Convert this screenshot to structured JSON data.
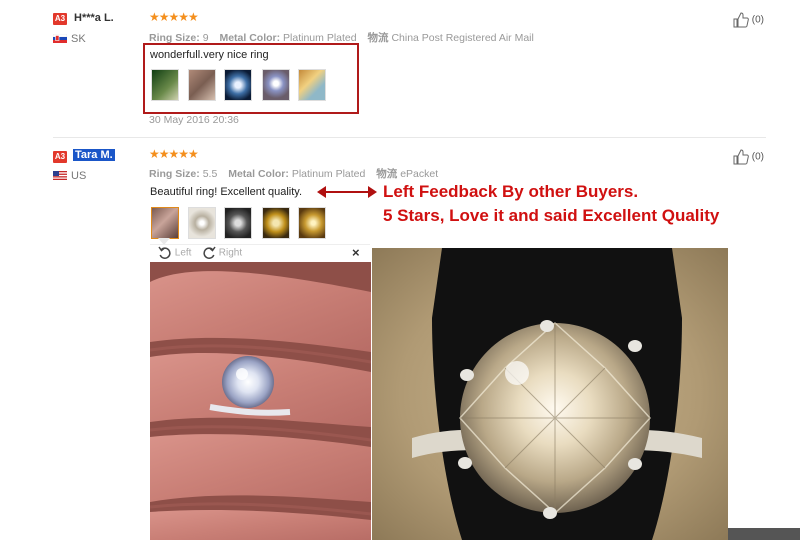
{
  "reviews": [
    {
      "badge": "A3",
      "name": "H***a L.",
      "country": "SK",
      "stars": "★★★★★",
      "ring_size_label": "Ring Size:",
      "ring_size": "9",
      "metal_label": "Metal Color:",
      "metal": "Platinum Plated",
      "shipping_label": "物流",
      "shipping": "China Post Registered Air Mail",
      "text": "wonderfull.very nice ring",
      "date": "30 May 2016 20:36",
      "likes": "(0)",
      "thumb_count": 5
    },
    {
      "badge": "A3",
      "name": "Tara M.",
      "country": "US",
      "stars": "★★★★★",
      "ring_size_label": "Ring Size:",
      "ring_size": "5.5",
      "metal_label": "Metal Color:",
      "metal": "Platinum Plated",
      "shipping_label": "物流",
      "shipping": "ePacket",
      "text": "Beautiful ring! Excellent quality.",
      "likes": "(0)",
      "thumb_count": 5
    }
  ],
  "viewer": {
    "left_label": "Left",
    "right_label": "Right",
    "close_label": "×"
  },
  "annotation": {
    "line1": "Left Feedback By other Buyers.",
    "line2": "5 Stars, Love it and said Excellent Quality",
    "color": "#d01010"
  },
  "colors": {
    "badge": "#e2382b",
    "stars": "#f48f1d",
    "highlight": "#1a56c8"
  }
}
